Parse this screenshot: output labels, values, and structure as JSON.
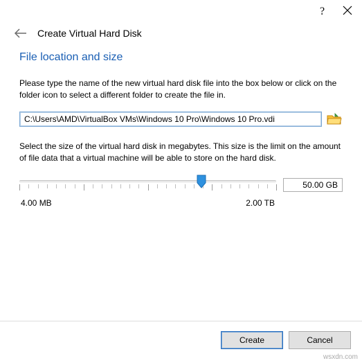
{
  "titlebar": {
    "help_symbol": "?",
    "close_symbol": "✕"
  },
  "header": {
    "title": "Create Virtual Hard Disk"
  },
  "section": {
    "heading": "File location and size",
    "location_text": "Please type the name of the new virtual hard disk file into the box below or click on the folder icon to select a different folder to create the file in.",
    "path_value": "C:\\Users\\AMD\\VirtualBox VMs\\Windows 10 Pro\\Windows 10 Pro.vdi",
    "size_text": "Select the size of the virtual hard disk in megabytes. This size is the limit on the amount of file data that a virtual machine will be able to store on the hard disk."
  },
  "slider": {
    "min_label": "4.00 MB",
    "max_label": "2.00 TB",
    "value_display": "50.00 GB",
    "min_mb": 4,
    "max_mb": 2097152,
    "value_mb": 51200,
    "thumb_percent": 71
  },
  "buttons": {
    "create": "Create",
    "cancel": "Cancel"
  },
  "watermark": "wsxdn.com"
}
